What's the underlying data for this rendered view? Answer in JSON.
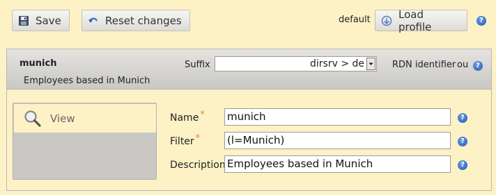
{
  "toolbar": {
    "save_label": "Save",
    "reset_label": "Reset changes",
    "profile_name": "default",
    "load_profile_label": "Load profile"
  },
  "header": {
    "title": "munich",
    "description": "Employees based in Munich",
    "suffix_label": "Suffix",
    "suffix_value": "dirsrv > de",
    "rdn_label": "RDN identifier",
    "rdn_value": "ou"
  },
  "sidebar": {
    "items": [
      {
        "label": "View",
        "icon": "magnifier-icon"
      }
    ]
  },
  "form": {
    "name_label": "Name",
    "name_value": "munich",
    "filter_label": "Filter",
    "filter_value": "(l=Munich)",
    "description_label": "Description",
    "description_value": "Employees based in Munich",
    "required_marker": "*"
  },
  "help_glyph": "?",
  "colors": {
    "background": "#fdf1c6",
    "required": "#e8802a",
    "help": "#2456b5"
  }
}
